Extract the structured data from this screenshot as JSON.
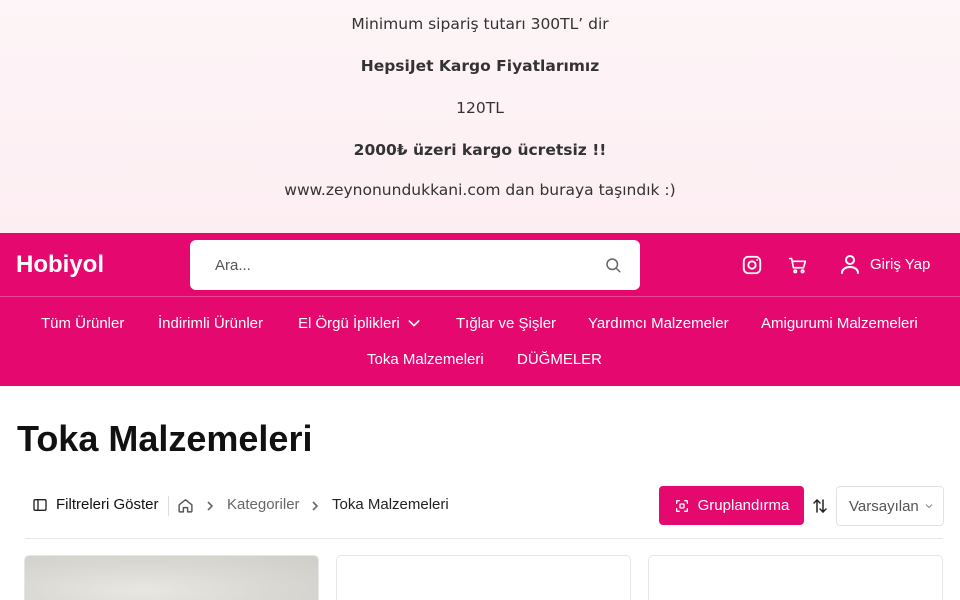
{
  "announcement": {
    "line1": "Minimum sipariş tutarı 300TL’ dir",
    "line2": "HepsiJet Kargo Fiyatlarımız",
    "line3": "120TL",
    "line4": "2000₺ üzeri kargo ücretsiz !!",
    "line5": "www.zeynonundukkani.com dan buraya taşındık :)"
  },
  "header": {
    "logo": "Hobiyol",
    "search_placeholder": "Ara...",
    "login_label": "Giriş Yap"
  },
  "nav": {
    "items": [
      "Tüm Ürünler",
      "İndirimli Ürünler",
      "El Örgü İplikleri",
      "Tığlar ve Şişler",
      "Yardımcı Malzemeler",
      "Amigurumi Malzemeleri",
      "Toka Malzemeleri",
      "DÜĞMELER"
    ]
  },
  "page": {
    "title": "Toka Malzemeleri",
    "filters_label": "Filtreleri Göster",
    "breadcrumb": [
      "Kategoriler",
      "Toka Malzemeleri"
    ],
    "group_label": "Gruplandırma",
    "sort_value": "Varsayılan"
  },
  "colors": {
    "brand": "#e5086f",
    "announcement_bg": "#fdf0f3"
  }
}
